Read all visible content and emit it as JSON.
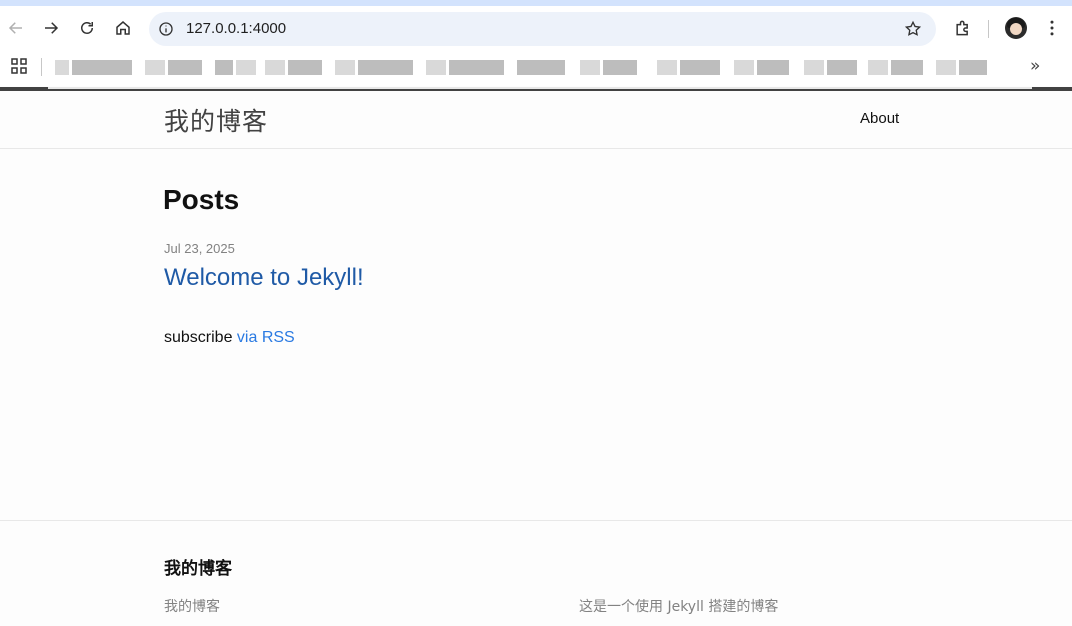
{
  "browser": {
    "url": "127.0.0.1:4000",
    "bookmarks_more": "»",
    "accent_color": "#d3e3fd",
    "omnibox_color": "#edf2fa"
  },
  "header": {
    "site_title": "我的博客",
    "nav_items": [
      {
        "label": "About"
      }
    ]
  },
  "main": {
    "heading": "Posts",
    "posts": [
      {
        "date": "Jul 23, 2025",
        "title": "Welcome to Jekyll!"
      }
    ],
    "subscribe_text": "subscribe ",
    "subscribe_link": "via RSS",
    "link_color": "#2a7ae2"
  },
  "footer": {
    "heading": "我的博客",
    "col1": "我的博客",
    "col2": "这是一个使用 Jekyll 搭建的博客"
  }
}
